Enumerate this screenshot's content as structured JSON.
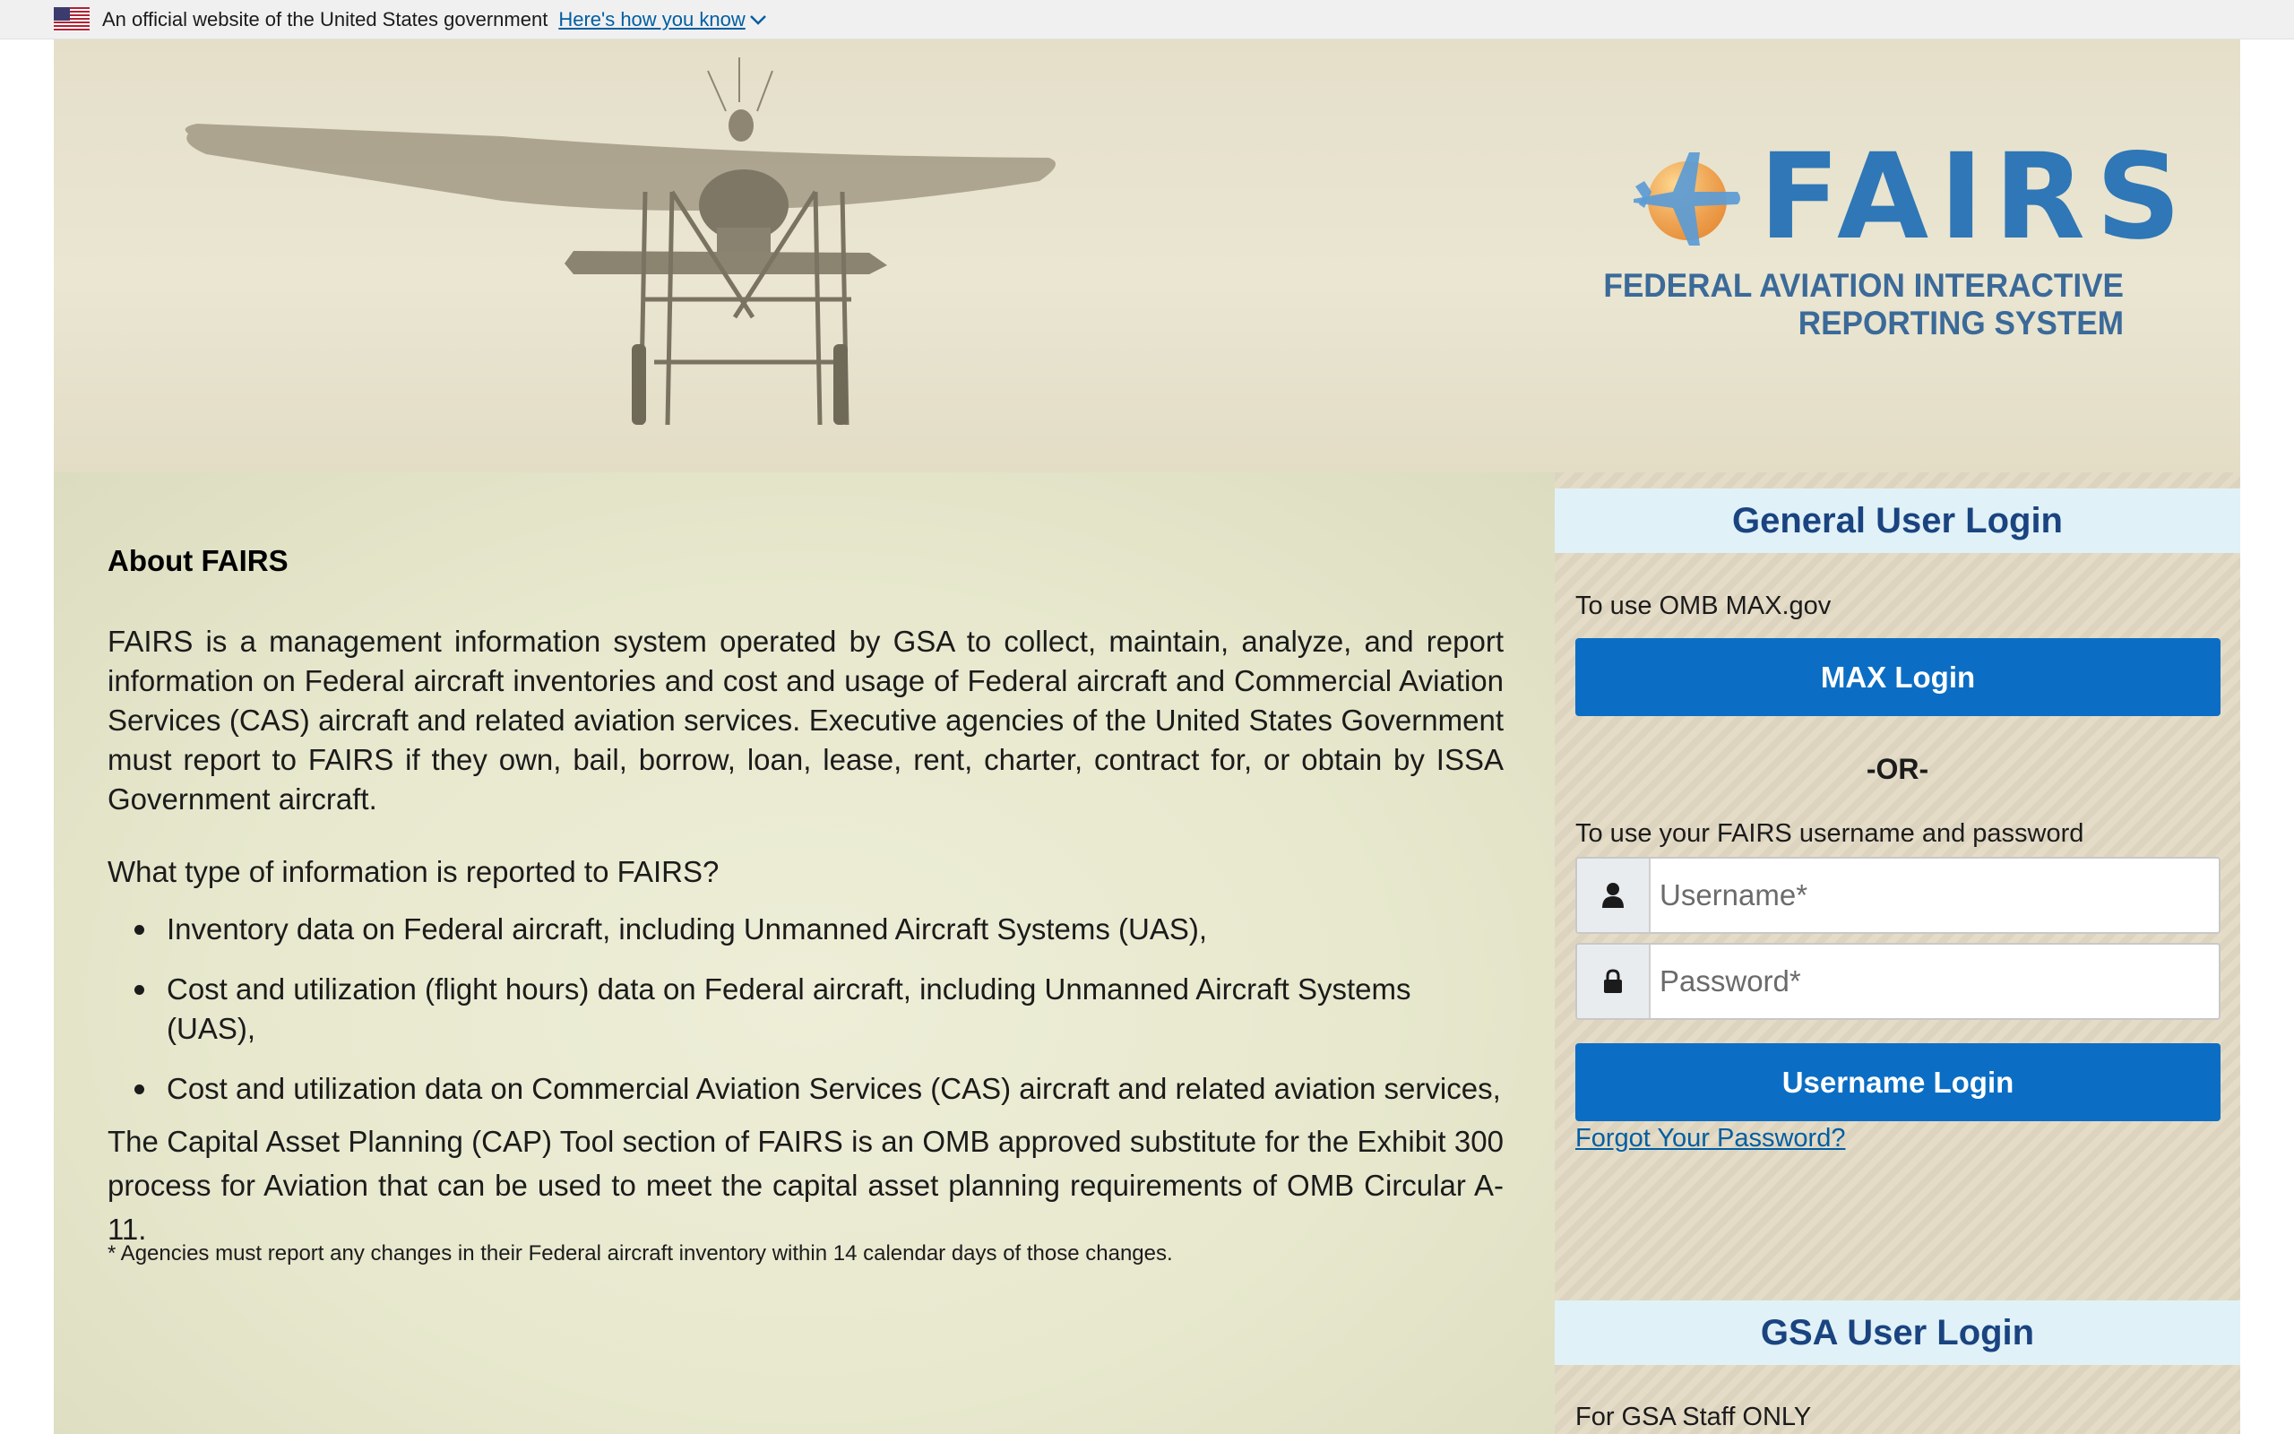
{
  "gov_banner": {
    "text": "An official website of the United States government",
    "link": "Here's how you know"
  },
  "header": {
    "logo_word": "FAIRS",
    "logo_subtitle": "FEDERAL AVIATION INTERACTIVE REPORTING SYSTEM"
  },
  "about": {
    "title": "About FAIRS",
    "paragraph1": "FAIRS is a management information system operated by GSA to collect, maintain, analyze, and report information on Federal aircraft inventories and cost and usage of Federal aircraft and Commercial Aviation Services (CAS) aircraft and related aviation services. Executive agencies of the United States Government must report to FAIRS if they own, bail, borrow, loan, lease, rent, charter, contract for, or obtain by ISSA Government aircraft.",
    "question": "What type of information is reported to FAIRS?",
    "bullets": [
      "Inventory data on Federal aircraft, including Unmanned Aircraft Systems (UAS),",
      "Cost and utilization (flight hours) data on Federal aircraft, including Unmanned Aircraft Systems (UAS),",
      "Cost and utilization data on Commercial Aviation Services (CAS) aircraft and related aviation services,"
    ],
    "paragraph3": "The Capital Asset Planning (CAP) Tool section of FAIRS is an OMB approved substitute for the Exhibit 300 process for Aviation that can be used to meet the capital asset planning requirements of OMB Circular A-11.",
    "footnote": "* Agencies must report any changes in their Federal aircraft inventory within 14 calendar days of those changes."
  },
  "general_login": {
    "title": "General User Login",
    "max_hint": "To use OMB MAX.gov",
    "max_button": "MAX Login",
    "or": "-OR-",
    "fairs_hint": "To use your FAIRS username and password",
    "username_placeholder": "Username*",
    "password_placeholder": "Password*",
    "username_button": "Username Login",
    "forgot": "Forgot Your Password?"
  },
  "gsa_login": {
    "title": "GSA User Login",
    "hint": "For GSA Staff ONLY"
  },
  "colors": {
    "primary_button": "#0b6ec4",
    "panel_header_bg": "#e1f1f8",
    "panel_header_text": "#1a4480",
    "link": "#005ea2",
    "logo_blue": "#2f77b6"
  },
  "icons": [
    "us-flag-icon",
    "chevron-down-icon",
    "user-icon",
    "lock-icon",
    "fairs-plane-emblem-icon"
  ]
}
